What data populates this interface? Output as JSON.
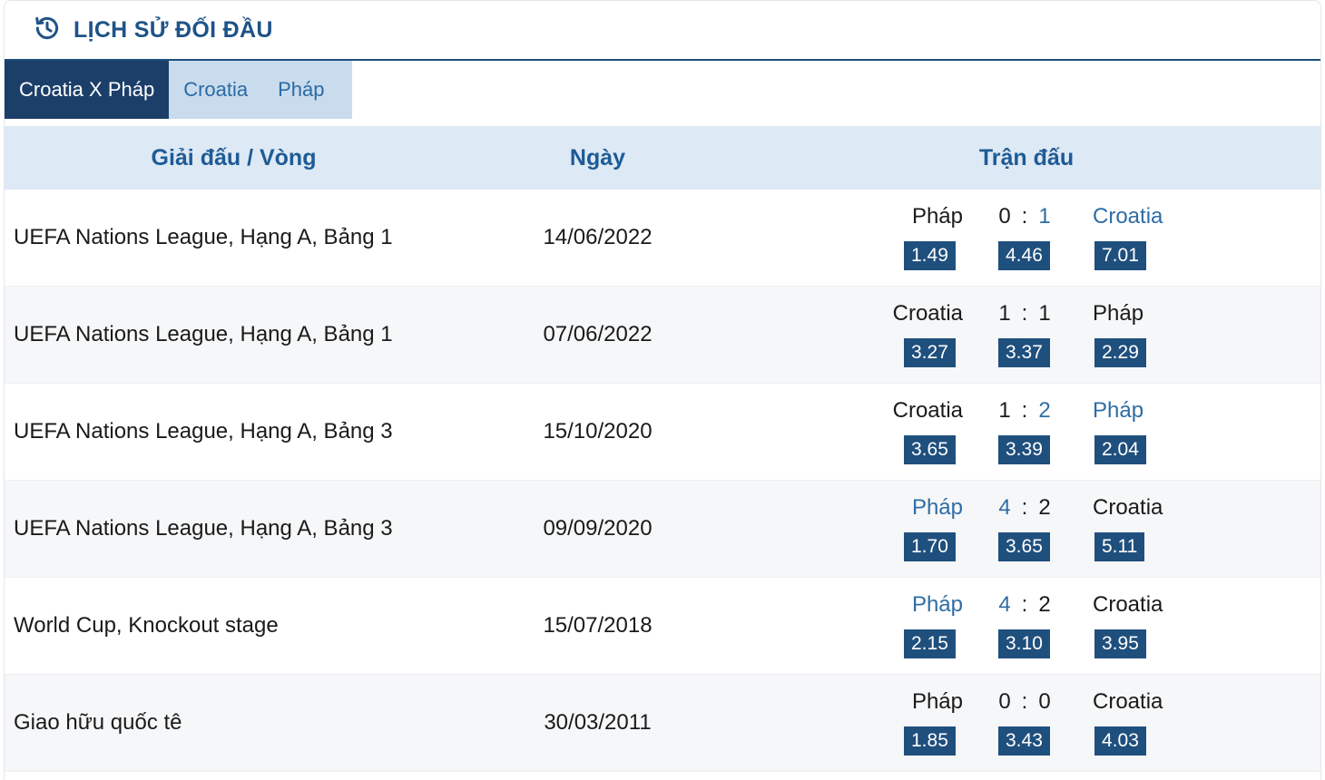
{
  "header": {
    "title": "LỊCH SỬ ĐỐI ĐẦU",
    "icon": "history-icon"
  },
  "tabs": [
    {
      "label": "Croatia X Pháp",
      "active": true
    },
    {
      "label": "Croatia",
      "active": false
    },
    {
      "label": "Pháp",
      "active": false
    }
  ],
  "columns": {
    "league": "Giải đấu / Vòng",
    "date": "Ngày",
    "match": "Trận đấu"
  },
  "colors": {
    "primary": "#1b3f69",
    "accent": "#2e6da4",
    "header_bg": "#dde9f4",
    "odds_bg": "#1f4f7d"
  },
  "rows": [
    {
      "league": "UEFA Nations League, Hạng A, Bảng 1",
      "date": "14/06/2022",
      "home": "Pháp",
      "away": "Croatia",
      "home_score": "0",
      "away_score": "1",
      "winner": "away",
      "odds": [
        "1.49",
        "4.46",
        "7.01"
      ]
    },
    {
      "league": "UEFA Nations League, Hạng A, Bảng 1",
      "date": "07/06/2022",
      "home": "Croatia",
      "away": "Pháp",
      "home_score": "1",
      "away_score": "1",
      "winner": "draw",
      "odds": [
        "3.27",
        "3.37",
        "2.29"
      ]
    },
    {
      "league": "UEFA Nations League, Hạng A, Bảng 3",
      "date": "15/10/2020",
      "home": "Croatia",
      "away": "Pháp",
      "home_score": "1",
      "away_score": "2",
      "winner": "away",
      "odds": [
        "3.65",
        "3.39",
        "2.04"
      ]
    },
    {
      "league": "UEFA Nations League, Hạng A, Bảng 3",
      "date": "09/09/2020",
      "home": "Pháp",
      "away": "Croatia",
      "home_score": "4",
      "away_score": "2",
      "winner": "home",
      "odds": [
        "1.70",
        "3.65",
        "5.11"
      ]
    },
    {
      "league": "World Cup, Knockout stage",
      "date": "15/07/2018",
      "home": "Pháp",
      "away": "Croatia",
      "home_score": "4",
      "away_score": "2",
      "winner": "home",
      "odds": [
        "2.15",
        "3.10",
        "3.95"
      ]
    },
    {
      "league": "Giao hữu quốc tê",
      "date": "30/03/2011",
      "home": "Pháp",
      "away": "Croatia",
      "home_score": "0",
      "away_score": "0",
      "winner": "draw",
      "odds": [
        "1.85",
        "3.43",
        "4.03"
      ]
    }
  ]
}
